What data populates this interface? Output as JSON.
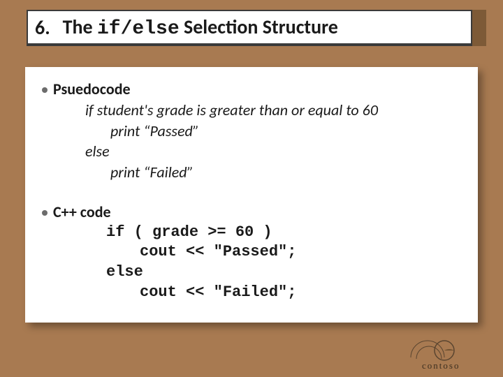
{
  "title": {
    "number": "6.",
    "prefix": "The ",
    "mono": "if/else",
    "suffix": " Selection Structure"
  },
  "pseudo": {
    "label": "Psuedocode",
    "line1": "if student's grade is greater than or equal to 60",
    "line2": "print “Passed”",
    "line3": "else",
    "line4": "print “Failed”"
  },
  "cpp": {
    "label": "C++ code",
    "line1": "if ( grade >= 60 )",
    "line2": "cout << \"Passed\";",
    "line3": "else",
    "line4": "cout << \"Failed\";"
  },
  "logo": {
    "text": "contoso"
  }
}
